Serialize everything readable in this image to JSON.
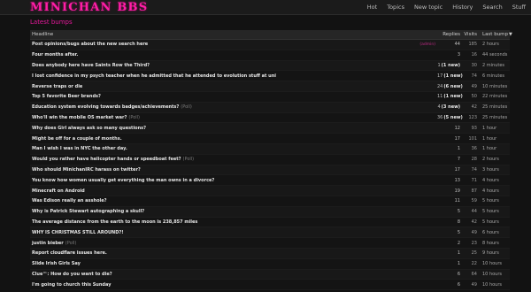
{
  "app": {
    "logo": "MINICHAN BBS"
  },
  "nav": {
    "items": [
      "Hot",
      "Topics",
      "New topic",
      "History",
      "Search",
      "Stuff"
    ]
  },
  "section": {
    "title": "Latest bumps"
  },
  "table": {
    "headers": {
      "headline": "Headline",
      "replies": "Replies",
      "visits": "Visits",
      "last_bump": "Last bump",
      "sort_arrow": "▼"
    },
    "rows": [
      {
        "headline": "Post opinions/bugs about the new search here",
        "author": "(admin)",
        "replies": "44",
        "new": "",
        "visits": "185",
        "last_bump": "2 hours"
      },
      {
        "headline": "Four months after.",
        "replies": "3",
        "new": "",
        "visits": "16",
        "last_bump": "44 seconds"
      },
      {
        "headline": "Does anybody here have Saints Row the Third?",
        "replies": "1",
        "new": "(1 new)",
        "visits": "30",
        "last_bump": "2 minutes"
      },
      {
        "headline": "I lost confidence in my psych teacher when he admitted that he attended to evolution stuff at uni",
        "replies": "17",
        "new": "(1 new)",
        "visits": "74",
        "last_bump": "6 minutes"
      },
      {
        "headline": "Reverse traps or die",
        "replies": "24",
        "new": "(6 new)",
        "visits": "49",
        "last_bump": "10 minutes"
      },
      {
        "headline": "Top 5 favorite Beer brands?",
        "replies": "11",
        "new": "(1 new)",
        "visits": "50",
        "last_bump": "22 minutes"
      },
      {
        "headline": "Education system evolving towards badges/achievements?",
        "poll": "(Poll)",
        "replies": "4",
        "new": "(3 new)",
        "visits": "42",
        "last_bump": "25 minutes"
      },
      {
        "headline": "Who'll win the mobile OS market war?",
        "poll": "(Poll)",
        "replies": "36",
        "new": "(5 new)",
        "visits": "123",
        "last_bump": "25 minutes"
      },
      {
        "headline": "Why does Girl always ask so many questions?",
        "replies": "12",
        "new": "",
        "visits": "93",
        "last_bump": "1 hour"
      },
      {
        "headline": "Might be off for a couple of months.",
        "replies": "17",
        "new": "",
        "visits": "101",
        "last_bump": "1 hour"
      },
      {
        "headline": "Man I wish I was in NYC the other day.",
        "replies": "1",
        "new": "",
        "visits": "36",
        "last_bump": "1 hour"
      },
      {
        "headline": "Would you rather have helicopter hands or speedboat feet?",
        "poll": "(Poll)",
        "replies": "7",
        "new": "",
        "visits": "28",
        "last_bump": "2 hours"
      },
      {
        "headline": "Who should MinichanIRC harass on twitter?",
        "replies": "17",
        "new": "",
        "visits": "74",
        "last_bump": "3 hours"
      },
      {
        "headline": "You know how women usually get everything the man owns in a divorce?",
        "replies": "13",
        "new": "",
        "visits": "71",
        "last_bump": "4 hours"
      },
      {
        "headline": "Minecraft on Android",
        "replies": "19",
        "new": "",
        "visits": "87",
        "last_bump": "4 hours"
      },
      {
        "headline": "Was Edison really an asshole?",
        "replies": "11",
        "new": "",
        "visits": "59",
        "last_bump": "5 hours"
      },
      {
        "headline": "Why is Patrick Stewart autographing a skull?",
        "replies": "5",
        "new": "",
        "visits": "44",
        "last_bump": "5 hours"
      },
      {
        "headline": "The average distance from the earth to the moon is 238,857 miles",
        "replies": "8",
        "new": "",
        "visits": "42",
        "last_bump": "5 hours"
      },
      {
        "headline": "WHY IS CHRISTMAS STILL AROUND?!",
        "replies": "5",
        "new": "",
        "visits": "49",
        "last_bump": "6 hours"
      },
      {
        "headline": "justin bieber",
        "poll": "(Poll)",
        "replies": "2",
        "new": "",
        "visits": "23",
        "last_bump": "8 hours"
      },
      {
        "headline": "Report cloudflare issues here.",
        "replies": "1",
        "new": "",
        "visits": "25",
        "last_bump": "9 hours"
      },
      {
        "headline": "Slide Irish Girls Say",
        "replies": "1",
        "new": "",
        "visits": "22",
        "last_bump": "10 hours"
      },
      {
        "headline": "Clue™: How do you want to die?",
        "replies": "6",
        "new": "",
        "visits": "64",
        "last_bump": "10 hours"
      },
      {
        "headline": "I'm going to church this Sunday",
        "replies": "6",
        "new": "",
        "visits": "49",
        "last_bump": "10 hours"
      }
    ]
  }
}
